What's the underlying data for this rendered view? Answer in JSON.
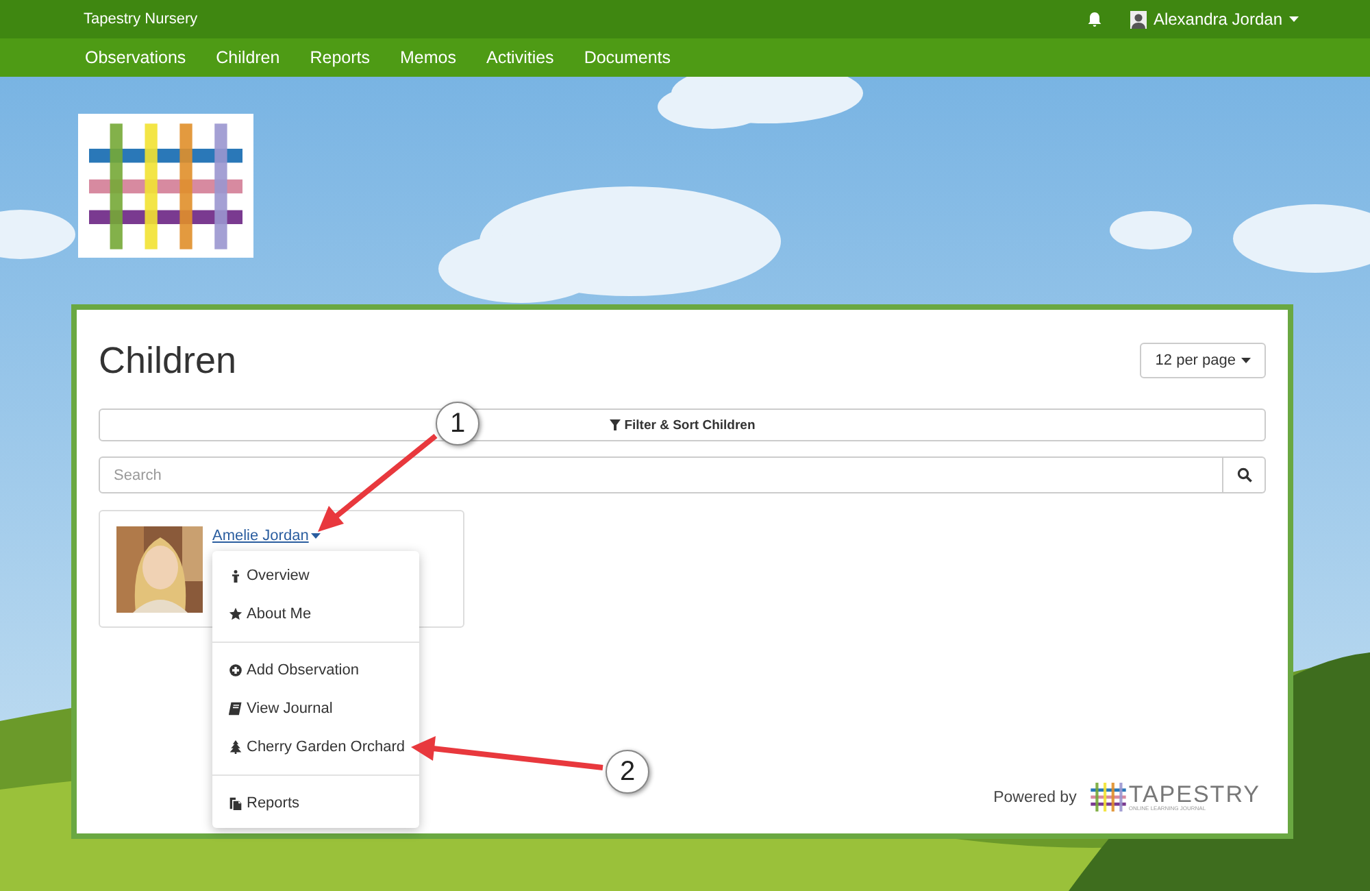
{
  "top_bar": {
    "brand": "Tapestry Nursery",
    "user": "Alexandra Jordan"
  },
  "nav": [
    {
      "label": "Observations"
    },
    {
      "label": "Children"
    },
    {
      "label": "Reports"
    },
    {
      "label": "Memos"
    },
    {
      "label": "Activities"
    },
    {
      "label": "Documents"
    }
  ],
  "page": {
    "title": "Children",
    "per_page": "12 per page",
    "filter_button": "Filter & Sort Children",
    "search": {
      "placeholder": "Search"
    }
  },
  "child_card": {
    "name": "Amelie Jordan",
    "photo": {
      "kind": "picture"
    },
    "menu_sections": [
      [
        {
          "label": "Overview"
        },
        {
          "label": "About Me"
        }
      ],
      [
        {
          "label": "Add Observation"
        },
        {
          "label": "View Journal"
        },
        {
          "label": "Cherry Garden Orchard"
        }
      ],
      [
        {
          "label": "Reports"
        }
      ]
    ]
  },
  "footer": {
    "powered_by": "Powered by",
    "logo_text": "TAPESTRY",
    "logo_tagline": "ONLINE LEARNING JOURNAL"
  },
  "callouts": [
    {
      "number": "1"
    },
    {
      "number": "2"
    }
  ]
}
